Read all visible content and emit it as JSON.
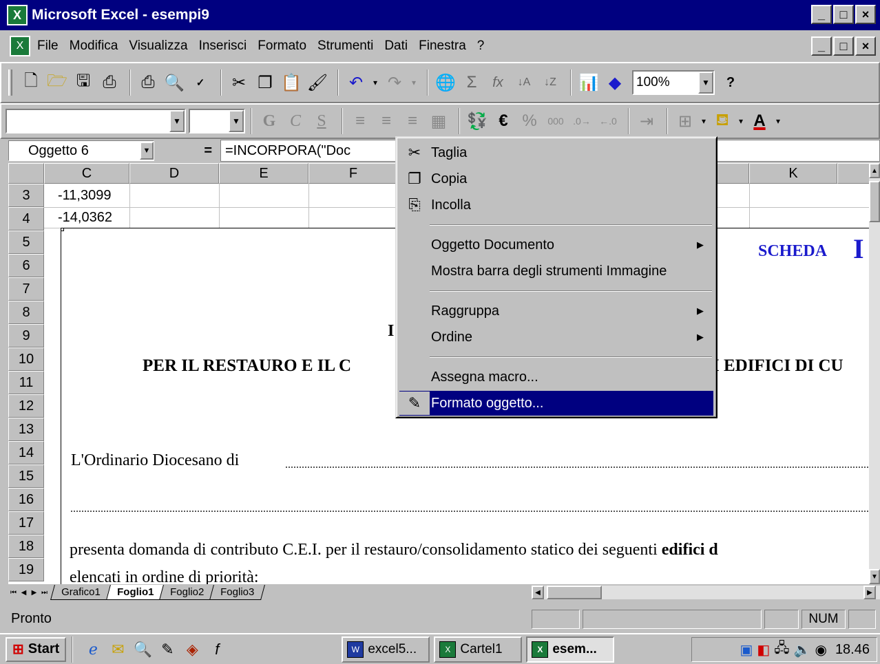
{
  "window": {
    "title": "Microsoft Excel - esempi9",
    "controls": [
      "_",
      "□",
      "×"
    ]
  },
  "menubar": {
    "items": [
      "File",
      "Modifica",
      "Visualizza",
      "Inserisci",
      "Formato",
      "Strumenti",
      "Dati",
      "Finestra",
      "?"
    ]
  },
  "toolbar": {
    "zoom": "100%",
    "bold_label": "G",
    "italic_label": "C",
    "underline_label": "S",
    "euro_label": "€",
    "percent_label": "%",
    "thousands_label": "000"
  },
  "formula_bar": {
    "name_box": "Oggetto 6",
    "equals": "=",
    "formula": "=INCORPORA(\"Doc"
  },
  "grid": {
    "columns": [
      "C",
      "D",
      "E",
      "F",
      "K"
    ],
    "rows": [
      "3",
      "4",
      "5",
      "6",
      "7",
      "8",
      "9",
      "10",
      "11",
      "12",
      "13",
      "14",
      "15",
      "16",
      "17",
      "18",
      "19"
    ],
    "cells": {
      "C3": "-11,3099",
      "C4": "-14,0362"
    }
  },
  "document": {
    "scheda": "SCHEDA",
    "scheda_suffix": "I",
    "heading_letter": "I",
    "title_left": "PER IL RESTAURO E IL C",
    "title_right": "I EDIFICI DI CU",
    "line1": "L'Ordinario Diocesano di",
    "line3_prefix": "presenta domanda di contributo C.E.I. per il restauro/consolidamento statico dei seguenti",
    "line3_bold": "edifici d",
    "line4": "elencati in ordine di priorità:"
  },
  "context_menu": {
    "items": [
      {
        "label": "Taglia",
        "icon": "scissors-icon",
        "glyph": "✂"
      },
      {
        "label": "Copia",
        "icon": "copy-icon",
        "glyph": "❐"
      },
      {
        "label": "Incolla",
        "icon": "paste-icon",
        "glyph": "⎘"
      },
      {
        "label": "Oggetto Documento",
        "submenu": true
      },
      {
        "label": "Mostra barra degli strumenti Immagine"
      },
      {
        "label": "Raggruppa",
        "submenu": true
      },
      {
        "label": "Ordine",
        "submenu": true
      },
      {
        "label": "Assegna macro..."
      },
      {
        "label": "Formato oggetto...",
        "icon": "format-object-icon",
        "glyph": "✎",
        "highlighted": true
      }
    ]
  },
  "sheet_tabs": [
    "Grafico1",
    "Foglio1",
    "Foglio2",
    "Foglio3"
  ],
  "active_sheet": "Foglio1",
  "status": {
    "text": "Pronto",
    "num": "NUM"
  },
  "taskbar": {
    "start": "Start",
    "tasks": [
      "excel5...",
      "Cartel1",
      "esem..."
    ],
    "clock": "18.46"
  },
  "colors": {
    "titlebar": "#000080",
    "highlight": "#000080",
    "doc_blue": "#1a1acc",
    "face": "#c0c0c0"
  }
}
